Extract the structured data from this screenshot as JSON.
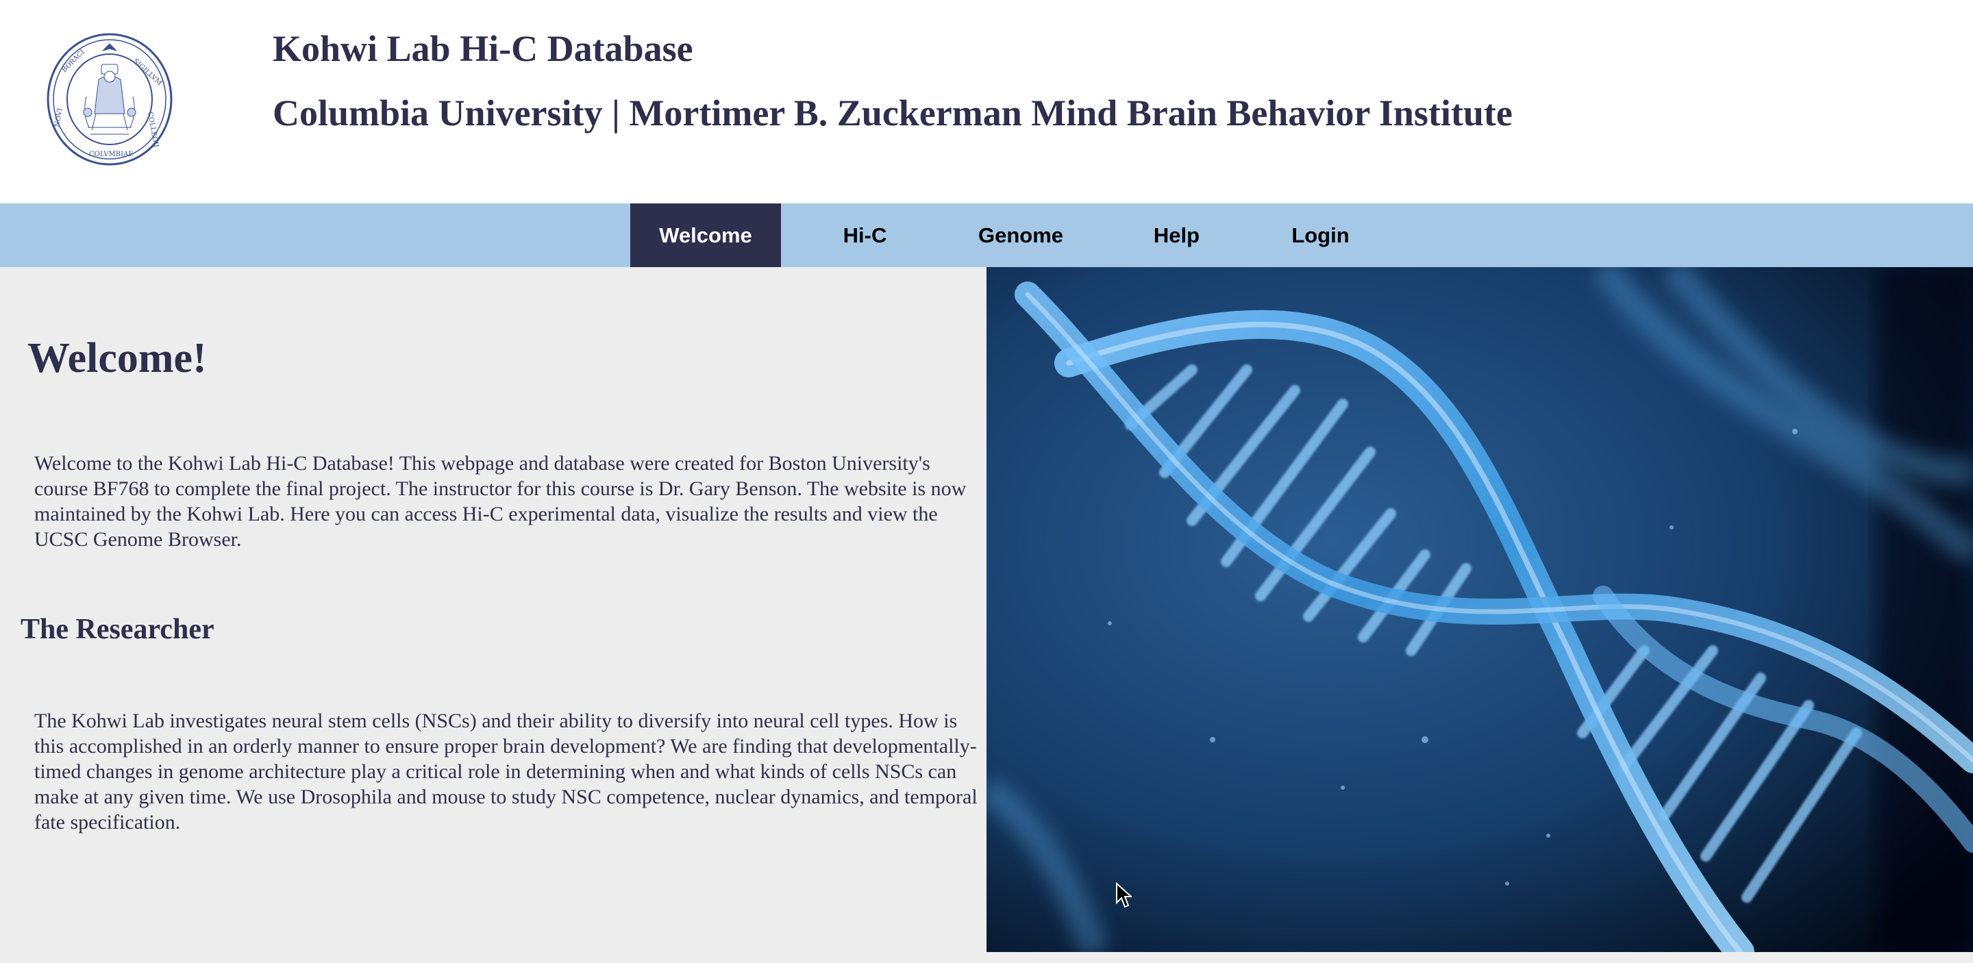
{
  "header": {
    "title": "Kohwi Lab Hi-C Database",
    "subtitle": "Columbia University | Mortimer B. Zuckerman Mind Brain Behavior Institute",
    "logo_icon": "columbia-university-seal"
  },
  "nav": {
    "items": [
      {
        "label": "Welcome",
        "active": true
      },
      {
        "label": "Hi-C",
        "active": false
      },
      {
        "label": "Genome",
        "active": false
      },
      {
        "label": "Help",
        "active": false
      },
      {
        "label": "Login",
        "active": false
      }
    ]
  },
  "main": {
    "welcome_heading": "Welcome!",
    "welcome_text": "Welcome to the Kohwi Lab Hi-C Database! This webpage and database were created for Boston University's course BF768 to complete the final project. The instructor for this course is Dr. Gary Benson. The website is now maintained by the Kohwi Lab. Here you can access Hi-C experimental data, visualize the results and view the UCSC Genome Browser.",
    "researcher_heading": "The Researcher",
    "researcher_text": "The Kohwi Lab investigates neural stem cells (NSCs) and their ability to diversify into neural cell types. How is this accomplished in an orderly manner to ensure proper brain development? We are finding that developmentally-timed changes in genome architecture play a critical role in determining when and what kinds of cells NSCs can make at any given time. We use Drosophila and mouse to study NSC competence, nuclear dynamics, and temporal fate specification."
  },
  "image": {
    "icon": "dna-double-helix-image"
  },
  "colors": {
    "navy": "#2e2e4d",
    "nav_bg": "#a5c8e6",
    "content_bg": "#ededed",
    "dna_blue": "#5fb3f0"
  }
}
